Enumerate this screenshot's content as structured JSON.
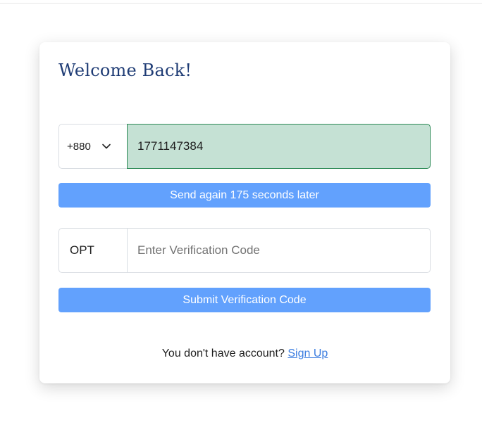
{
  "login": {
    "title": "Welcome Back!",
    "phone": {
      "country_code": "+880",
      "number": "1771147384"
    },
    "send_again_label": "Send again 175 seconds later",
    "otp": {
      "label": "OPT",
      "placeholder": "Enter Verification Code",
      "value": ""
    },
    "submit_label": "Submit Verification Code",
    "signup_prompt": "You don't have account?",
    "signup_link": "Sign Up"
  },
  "icons": {
    "country_dropdown": "chevron-down-icon"
  },
  "colors": {
    "title": "#1f3c75",
    "button_bg": "#62a1fd",
    "phone_field_bg": "#c5e1d4",
    "phone_field_border": "#2e8b57",
    "link": "#3d7ee0"
  }
}
